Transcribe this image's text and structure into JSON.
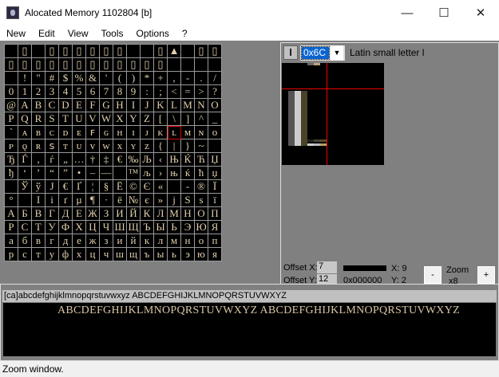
{
  "window": {
    "title": "Alocated Memory 1102804 [b]",
    "minimize": "—",
    "maximize": "☐",
    "close": "✕"
  },
  "menu": [
    "New",
    "Edit",
    "View",
    "Tools",
    "Options",
    "?"
  ],
  "grid": {
    "rows": [
      [
        "",
        "▯",
        "",
        "▯",
        "▯",
        "▯",
        "▯",
        "▯",
        "▯",
        "",
        "",
        "▯",
        "▲",
        "",
        "▯",
        "▯"
      ],
      [
        "▯",
        "▯",
        "▯",
        "▯",
        "▯",
        "▯",
        "▯",
        "▯",
        "▯",
        "▯",
        "▯",
        "▯",
        "",
        "",
        "",
        ""
      ],
      [
        " ",
        "!",
        "\"",
        "#",
        "$",
        "%",
        "&",
        "'",
        "(",
        ")",
        "*",
        "+",
        ",",
        "-",
        ".",
        "/"
      ],
      [
        "0",
        "1",
        "2",
        "3",
        "4",
        "5",
        "6",
        "7",
        "8",
        "9",
        ":",
        ";",
        "<",
        "=",
        ">",
        "?"
      ],
      [
        "@",
        "A",
        "B",
        "C",
        "D",
        "E",
        "F",
        "G",
        "H",
        "I",
        "J",
        "K",
        "L",
        "M",
        "N",
        "O"
      ],
      [
        "P",
        "Q",
        "R",
        "S",
        "T",
        "U",
        "V",
        "W",
        "X",
        "Y",
        "Z",
        "[",
        "\\",
        "]",
        "^",
        "_"
      ],
      [
        "`",
        "ᴀ",
        "ʙ",
        "ᴄ",
        "ᴅ",
        "ᴇ",
        "ꜰ",
        "ɢ",
        "ʜ",
        "ɪ",
        "ᴊ",
        "ᴋ",
        "ʟ",
        "ᴍ",
        "ɴ",
        "ᴏ"
      ],
      [
        "ᴘ",
        "ǫ",
        "ʀ",
        "ꜱ",
        "ᴛ",
        "ᴜ",
        "ᴠ",
        "ᴡ",
        "x",
        "ʏ",
        "ᴢ",
        "{",
        "|",
        "}",
        "~",
        ""
      ],
      [
        "Ђ",
        "Ѓ",
        "‚",
        "ѓ",
        "„",
        "…",
        "†",
        "‡",
        "€",
        "‰",
        "Љ",
        "‹",
        "Њ",
        "Ќ",
        "Ћ",
        "Џ"
      ],
      [
        "ђ",
        "‘",
        "’",
        "“",
        "”",
        "•",
        "–",
        "—",
        "",
        "™",
        "љ",
        "›",
        "њ",
        "ќ",
        "ћ",
        "џ"
      ],
      [
        "",
        "Ў",
        "ў",
        "Ј",
        "€",
        "Ґ",
        "¦",
        "§",
        "Ё",
        "©",
        "Є",
        "«",
        "",
        "-",
        "®",
        "Ї"
      ],
      [
        "°",
        "",
        "І",
        "і",
        "ґ",
        "µ",
        "¶",
        "·",
        "ё",
        "№",
        "є",
        "»",
        "ј",
        "Ѕ",
        "ѕ",
        "ї"
      ],
      [
        "А",
        "Б",
        "В",
        "Г",
        "Д",
        "Е",
        "Ж",
        "З",
        "И",
        "Й",
        "К",
        "Л",
        "М",
        "Н",
        "О",
        "П"
      ],
      [
        "Р",
        "С",
        "Т",
        "У",
        "Ф",
        "Х",
        "Ц",
        "Ч",
        "Ш",
        "Щ",
        "Ъ",
        "Ы",
        "Ь",
        "Э",
        "Ю",
        "Я"
      ],
      [
        "а",
        "б",
        "в",
        "г",
        "д",
        "е",
        "ж",
        "з",
        "и",
        "й",
        "к",
        "л",
        "м",
        "н",
        "о",
        "п"
      ],
      [
        "р",
        "с",
        "т",
        "у",
        "ф",
        "х",
        "ц",
        "ч",
        "ш",
        "щ",
        "ъ",
        "ы",
        "ь",
        "э",
        "ю",
        "я"
      ]
    ],
    "selected_code": 108
  },
  "editor": {
    "char": "l",
    "code": "0x6C",
    "dropdown": "▼",
    "name": "Latin small letter l",
    "offset_x_label": "Offset X:",
    "offset_x": "7",
    "offset_y_label": "Offset Y:",
    "offset_y": "12",
    "color_hex": "0x000000",
    "color": "#000000",
    "x_label": "X: 9",
    "y_label": "Y: 2",
    "zoom_out": "-",
    "zoom_in": "+",
    "zoom_label": "Zoom",
    "zoom_value": "x8"
  },
  "sample_text": "[ca]abcdefghijklmnopqrstuvwxyz ABCDEFGHIJKLMNOPQRSTUVWXYZ",
  "preview_text": "ABCDEFGHIJKLMNOPQRSTUVWXYZ ABCDEFGHIJKLMNOPQRSTUVWXYZ",
  "status": "Zoom window."
}
